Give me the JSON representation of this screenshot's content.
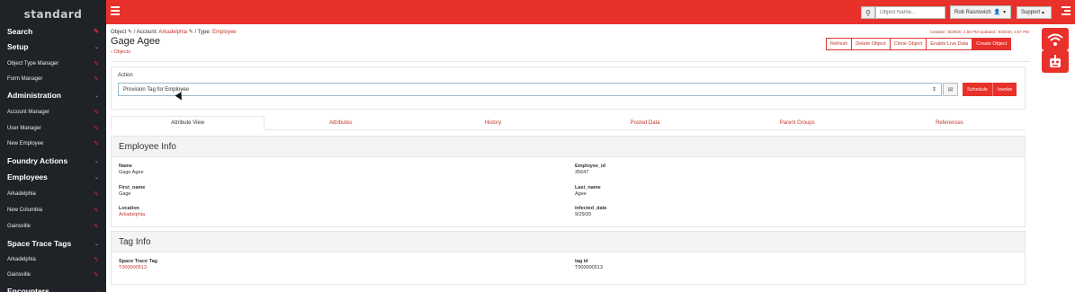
{
  "brand": "standard",
  "sidebar": {
    "items": [
      {
        "label": "Search",
        "type": "header",
        "icon": "pencil-icon"
      },
      {
        "label": "Setup",
        "type": "header",
        "icon": "chevron-down-icon"
      },
      {
        "label": "Object Type Manager",
        "type": "sub",
        "icon": "pencil-icon"
      },
      {
        "label": "Form Manager",
        "type": "sub",
        "icon": "pencil-icon"
      },
      {
        "label": "Administration",
        "type": "header",
        "icon": "chevron-down-icon"
      },
      {
        "label": "Account Manager",
        "type": "sub",
        "icon": "pencil-icon"
      },
      {
        "label": "User Manager",
        "type": "sub",
        "icon": "pencil-icon"
      },
      {
        "label": "New Employee",
        "type": "sub",
        "icon": "pencil-icon"
      },
      {
        "label": "Foundry Actions",
        "type": "header",
        "icon": "chevron-down-icon"
      },
      {
        "label": "Employees",
        "type": "header",
        "icon": "chevron-down-icon"
      },
      {
        "label": "Arkadelphia",
        "type": "sub",
        "icon": "pencil-icon"
      },
      {
        "label": "New Columbia",
        "type": "sub",
        "icon": "pencil-icon"
      },
      {
        "label": "Gainsville",
        "type": "sub",
        "icon": "pencil-icon"
      },
      {
        "label": "Space Trace Tags",
        "type": "header",
        "icon": "chevron-down-icon"
      },
      {
        "label": "Arkadelphia",
        "type": "sub",
        "icon": "pencil-icon"
      },
      {
        "label": "Gainsville",
        "type": "sub",
        "icon": "pencil-icon"
      },
      {
        "label": "Encounters",
        "type": "header",
        "icon": "chevron-down-icon"
      }
    ]
  },
  "topbar": {
    "search_placeholder": "Object Name...",
    "user_name": "Rob Rasnovich",
    "support_label": "Support"
  },
  "header": {
    "crumb_object": "Object",
    "crumb_account_prefix": "/ Account:",
    "crumb_account": "Arkadelphia",
    "crumb_type_prefix": "/ Type:",
    "crumb_type": "Employee",
    "title": "Gage Agee",
    "back_link": "‹ Objects",
    "timestamps": "Created : 9/29/20, 4:56 PM  Updated : 9/29/20, 4:57 PM"
  },
  "actions": [
    "Refresh",
    "Delete Object",
    "Clone Object",
    "Enable Live Data",
    "Create Object"
  ],
  "action_panel": {
    "label": "Action",
    "selected": "Provision Tag for Employee",
    "schedule": "Schedule",
    "invoke": "Invoke"
  },
  "tabs": [
    "Attribute View",
    "Attributes",
    "History",
    "Posted Data",
    "Parent Groups",
    "References"
  ],
  "employee_info": {
    "title": "Employee Info",
    "name_label": "Name",
    "name": "Gage Agee",
    "employee_id_label": "Employee_id",
    "employee_id": "35647",
    "first_name_label": "First_name",
    "first_name": "Gage",
    "last_name_label": "Last_name",
    "last_name": "Agee",
    "location_label": "Location",
    "location": "Arkadelphia",
    "infected_date_label": "infected_date",
    "infected_date": "9/29/20"
  },
  "tag_info": {
    "title": "Tag Info",
    "space_trace_tag_label": "Space Trace Tag",
    "space_trace_tag": "T000000513",
    "tag_id_label": "tag id",
    "tag_id": "T000000513"
  },
  "colors": {
    "accent": "#e8312a",
    "sidebar_bg": "#1f2328",
    "link": "#c0392b"
  }
}
